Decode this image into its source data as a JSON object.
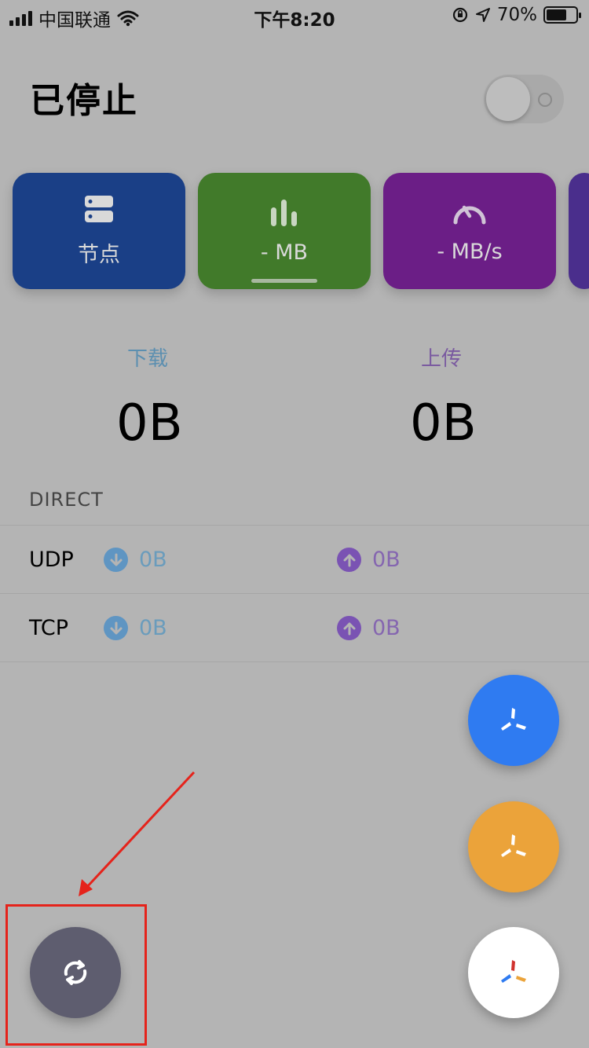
{
  "status_bar": {
    "carrier": "中国联通",
    "time": "下午8:20",
    "battery": "70%",
    "battery_level": 0.7
  },
  "header": {
    "title": "已停止",
    "vpn_toggle_on": false
  },
  "cards": [
    {
      "name": "nodes",
      "icon": "server-icon",
      "label": "节点",
      "color": "#1a3f86"
    },
    {
      "name": "traffic",
      "icon": "bar-chart-icon",
      "label": "- MB",
      "color": "#417a2a",
      "selected": true
    },
    {
      "name": "speed",
      "icon": "speedometer-icon",
      "label": "- MB/s",
      "color": "#6b1e86"
    },
    {
      "name": "more",
      "icon": "",
      "label": "",
      "color": "#4a2e8c"
    }
  ],
  "traffic": {
    "download_label": "下载",
    "download_value": "0B",
    "upload_label": "上传",
    "upload_value": "0B"
  },
  "direct": {
    "title": "DIRECT",
    "rows": [
      {
        "protocol": "UDP",
        "download": "0B",
        "upload": "0B"
      },
      {
        "protocol": "TCP",
        "download": "0B",
        "upload": "0B"
      }
    ]
  },
  "fabs": {
    "blue": {
      "icon": "propeller-icon",
      "color": "#2f7bf1"
    },
    "orange": {
      "icon": "propeller-icon",
      "color": "#eba33a"
    },
    "white": {
      "icon": "propeller-color-icon",
      "color": "#ffffff"
    },
    "refresh": {
      "icon": "refresh-icon",
      "color": "#5e5d6f"
    }
  },
  "annotation": {
    "color": "#e5231b"
  }
}
